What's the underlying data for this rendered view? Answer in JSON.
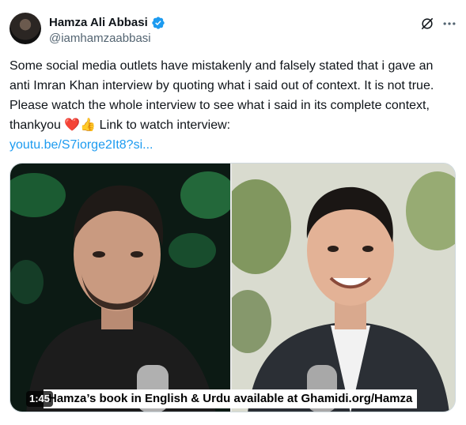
{
  "author": {
    "name": "Hamza Ali Abbasi",
    "handle": "@iamhamzaabbasi",
    "verified_icon": "verified-badge-icon"
  },
  "actions": {
    "grok_icon": "grok-icon",
    "more_icon": "more-icon"
  },
  "tweet": {
    "text_main": "Some social media outlets have mistakenly and falsely stated that i gave an anti Imran Khan interview by quoting what i said out of context. It is not true. Please watch the whole interview to see what i said in its complete context, thankyou ",
    "emoji_heart": "❤️",
    "emoji_thumbs": "👍",
    "text_after_emoji": " Link to watch interview:",
    "link": "youtu.be/S7iorge2It8?si..."
  },
  "media": {
    "duration": "1:45",
    "caption": "Hamza’s book in English & Urdu available at Ghamidi.org/Hamza"
  },
  "colors": {
    "accent": "#1d9bf0",
    "text": "#0f1419",
    "secondary": "#536471"
  }
}
